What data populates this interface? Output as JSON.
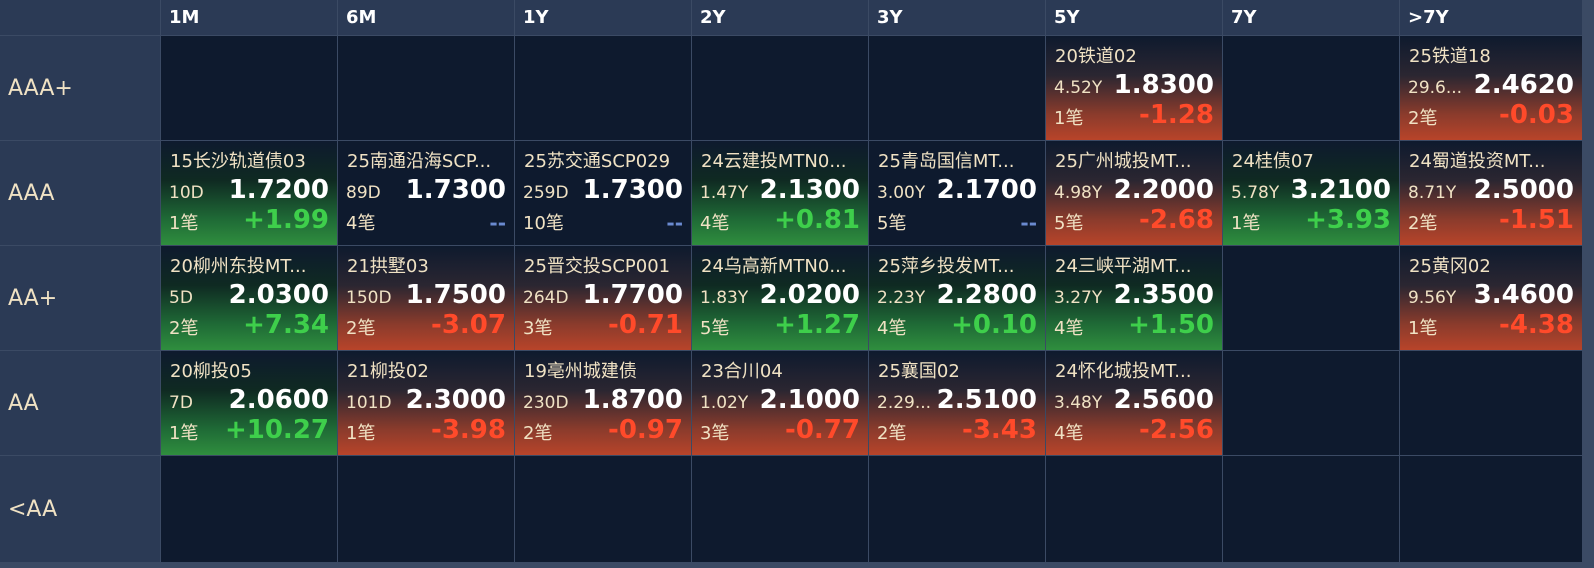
{
  "columns": [
    "1M",
    "6M",
    "1Y",
    "2Y",
    "3Y",
    "5Y",
    "7Y",
    ">7Y"
  ],
  "rows": [
    {
      "rating": "AAA+",
      "cells": [
        null,
        null,
        null,
        null,
        null,
        {
          "name": "20铁道02",
          "term": "4.52Y",
          "yield": "1.8300",
          "trades": "1笔",
          "change": "-1.28",
          "trend": "down"
        },
        null,
        {
          "name": "25铁道18",
          "term": "29.6...",
          "yield": "2.4620",
          "trades": "2笔",
          "change": "-0.03",
          "trend": "down"
        }
      ]
    },
    {
      "rating": "AAA",
      "cells": [
        {
          "name": "15长沙轨道债03",
          "term": "10D",
          "yield": "1.7200",
          "trades": "1笔",
          "change": "+1.99",
          "trend": "up"
        },
        {
          "name": "25南通沿海SCP...",
          "term": "89D",
          "yield": "1.7300",
          "trades": "4笔",
          "change": "--",
          "trend": "flat"
        },
        {
          "name": "25苏交通SCP029",
          "term": "259D",
          "yield": "1.7300",
          "trades": "10笔",
          "change": "--",
          "trend": "flat"
        },
        {
          "name": "24云建投MTN0...",
          "term": "1.47Y",
          "yield": "2.1300",
          "trades": "4笔",
          "change": "+0.81",
          "trend": "up"
        },
        {
          "name": "25青岛国信MT...",
          "term": "3.00Y",
          "yield": "2.1700",
          "trades": "5笔",
          "change": "--",
          "trend": "flat"
        },
        {
          "name": "25广州城投MT...",
          "term": "4.98Y",
          "yield": "2.2000",
          "trades": "5笔",
          "change": "-2.68",
          "trend": "down"
        },
        {
          "name": "24桂债07",
          "term": "5.78Y",
          "yield": "3.2100",
          "trades": "1笔",
          "change": "+3.93",
          "trend": "up"
        },
        {
          "name": "24蜀道投资MT...",
          "term": "8.71Y",
          "yield": "2.5000",
          "trades": "2笔",
          "change": "-1.51",
          "trend": "down"
        }
      ]
    },
    {
      "rating": "AA+",
      "cells": [
        {
          "name": "20柳州东投MT...",
          "term": "5D",
          "yield": "2.0300",
          "trades": "2笔",
          "change": "+7.34",
          "trend": "up"
        },
        {
          "name": "21拱墅03",
          "term": "150D",
          "yield": "1.7500",
          "trades": "2笔",
          "change": "-3.07",
          "trend": "down"
        },
        {
          "name": "25晋交投SCP001",
          "term": "264D",
          "yield": "1.7700",
          "trades": "3笔",
          "change": "-0.71",
          "trend": "down"
        },
        {
          "name": "24乌高新MTN0...",
          "term": "1.83Y",
          "yield": "2.0200",
          "trades": "5笔",
          "change": "+1.27",
          "trend": "up"
        },
        {
          "name": "25萍乡投发MT...",
          "term": "2.23Y",
          "yield": "2.2800",
          "trades": "4笔",
          "change": "+0.10",
          "trend": "up"
        },
        {
          "name": "24三峡平湖MT...",
          "term": "3.27Y",
          "yield": "2.3500",
          "trades": "4笔",
          "change": "+1.50",
          "trend": "up"
        },
        null,
        {
          "name": "25黄冈02",
          "term": "9.56Y",
          "yield": "3.4600",
          "trades": "1笔",
          "change": "-4.38",
          "trend": "down"
        }
      ]
    },
    {
      "rating": "AA",
      "cells": [
        {
          "name": "20柳投05",
          "term": "7D",
          "yield": "2.0600",
          "trades": "1笔",
          "change": "+10.27",
          "trend": "up"
        },
        {
          "name": "21柳投02",
          "term": "101D",
          "yield": "2.3000",
          "trades": "1笔",
          "change": "-3.98",
          "trend": "down"
        },
        {
          "name": "19亳州城建债",
          "term": "230D",
          "yield": "1.8700",
          "trades": "2笔",
          "change": "-0.97",
          "trend": "down"
        },
        {
          "name": "23合川04",
          "term": "1.02Y",
          "yield": "2.1000",
          "trades": "3笔",
          "change": "-0.77",
          "trend": "down"
        },
        {
          "name": "25襄国02",
          "term": "2.29...",
          "yield": "2.5100",
          "trades": "2笔",
          "change": "-3.43",
          "trend": "down"
        },
        {
          "name": "24怀化城投MT...",
          "term": "3.48Y",
          "yield": "2.5600",
          "trades": "4笔",
          "change": "-2.56",
          "trend": "down"
        },
        null,
        null
      ]
    },
    {
      "rating": "<AA",
      "cells": [
        null,
        null,
        null,
        null,
        null,
        null,
        null,
        null
      ]
    }
  ]
}
